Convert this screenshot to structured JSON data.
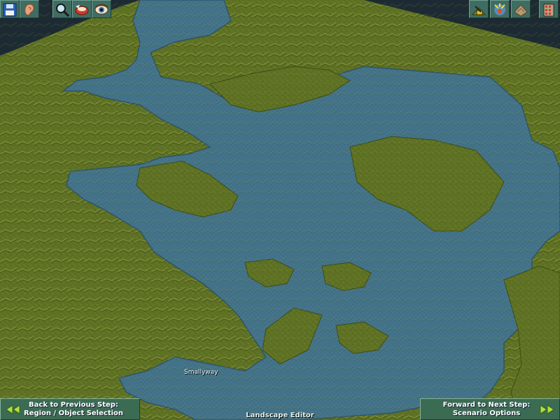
{
  "toolbar": {
    "left": [
      {
        "icon": "save-icon"
      },
      {
        "icon": "ear-icon"
      },
      {
        "icon": "magnifier-icon"
      },
      {
        "icon": "rotate-icon"
      },
      {
        "icon": "eye-icon"
      }
    ],
    "right": [
      {
        "icon": "land-tool-icon"
      },
      {
        "icon": "water-tool-icon"
      },
      {
        "icon": "scenery-icon"
      },
      {
        "icon": "building-list-icon"
      }
    ]
  },
  "map": {
    "town_label": "Smallyway",
    "colors": {
      "water": "#45758c",
      "land": "#5f7226",
      "void": "#1c2a33"
    }
  },
  "footer": {
    "back_line1": "Back to Previous Step:",
    "back_line2": "Region / Object Selection",
    "forward_line1": "Forward to Next Step:",
    "forward_line2": "Scenario Options",
    "editor_title": "Landscape Editor"
  }
}
